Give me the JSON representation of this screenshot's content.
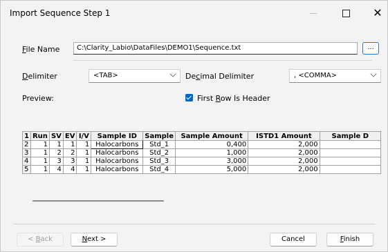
{
  "window": {
    "title": "Import Sequence Step 1",
    "minimize_icon": "minimize-icon",
    "maximize_icon": "maximize-icon",
    "close_glyph": "✕"
  },
  "file": {
    "label_accel": "F",
    "label_rest": "ile Name",
    "value": "C:\\Clarity_Labio\\DataFiles\\DEMO1\\Sequence.txt",
    "browse_label": "..."
  },
  "delimiter": {
    "label_accel": "D",
    "label_rest": "elimiter",
    "value": "<TAB>"
  },
  "decimal": {
    "label_pre": "De",
    "label_accel": "c",
    "label_rest": "imal Delimiter",
    "value": ", <COMMA>"
  },
  "preview": {
    "label": "Preview:"
  },
  "first_row": {
    "label_pre": "First ",
    "label_accel": "R",
    "label_rest": "ow Is Header",
    "checked": true
  },
  "table": {
    "headers": [
      "1",
      "Run",
      "SV",
      "EV",
      "I/V",
      "Sample ID",
      "Sample",
      "Sample Amount",
      "ISTD1 Amount",
      "Sample D"
    ],
    "rows": [
      [
        "2",
        "1",
        "1",
        "1",
        "1",
        "Halocarbons",
        "Std_1",
        "0,400",
        "2,000",
        ""
      ],
      [
        "3",
        "1",
        "2",
        "2",
        "1",
        "Halocarbons",
        "Std_2",
        "1,000",
        "2,000",
        ""
      ],
      [
        "4",
        "1",
        "3",
        "3",
        "1",
        "Halocarbons",
        "Std_3",
        "3,000",
        "2,000",
        ""
      ],
      [
        "5",
        "1",
        "4",
        "4",
        "1",
        "Halocarbons",
        "Std_4",
        "5,000",
        "2,000",
        ""
      ]
    ]
  },
  "buttons": {
    "back_pre": "< ",
    "back_accel": "B",
    "back_rest": "ack",
    "next_accel": "N",
    "next_rest": "ext >",
    "cancel": "Cancel",
    "finish_accel": "F",
    "finish_rest": "inish"
  },
  "colors": {
    "accent": "#0067c0"
  }
}
